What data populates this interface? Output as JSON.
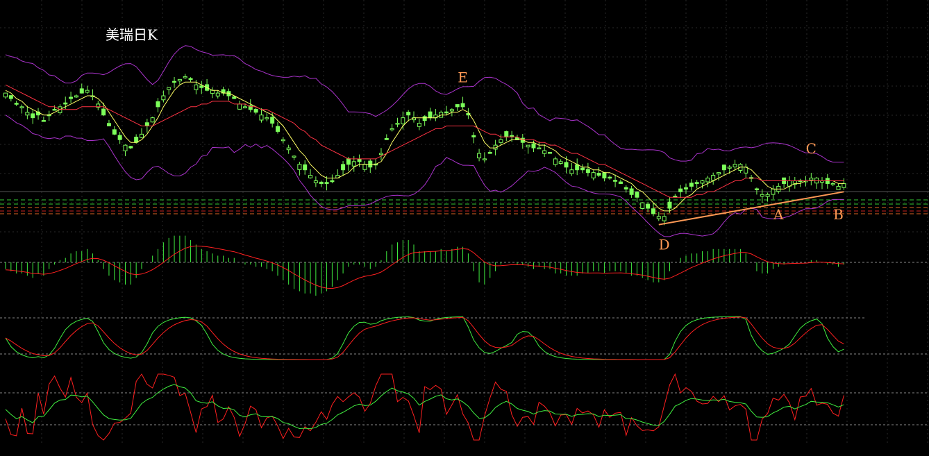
{
  "title": "美瑞日K",
  "colors": {
    "background": "#000000",
    "candle": "#7CFF5A",
    "ma_short": "#ffff66",
    "ma_long": "#ff3344",
    "bollinger": "#aa33cc",
    "annotation": "#ff9955",
    "macd_bar": "#40ee40",
    "macd_signal": "#ff2020",
    "kdj_fast": "#40ee40",
    "kdj_slow": "#ff2020",
    "ref_green": "#33cc33",
    "ref_orange": "#dd6622",
    "ref_red": "#cc2222"
  },
  "annotations": [
    {
      "label": "E",
      "i": 84
    },
    {
      "label": "D",
      "i": 121
    },
    {
      "label": "A",
      "i": 142
    },
    {
      "label": "C",
      "i": 148
    },
    {
      "label": "B",
      "i": 153
    }
  ],
  "trendline": {
    "from": 120,
    "to": 154
  },
  "chart_data": {
    "type": "candlestick",
    "closes": [
      112,
      110,
      108,
      107,
      105,
      103,
      104,
      102,
      104,
      106,
      107,
      108,
      110,
      111,
      112,
      113,
      111,
      108,
      104,
      100,
      97,
      95,
      93,
      92,
      94,
      97,
      100,
      103,
      107,
      111,
      114,
      116,
      117,
      118,
      117,
      115,
      114,
      113,
      113,
      112,
      112,
      111,
      110,
      108,
      107,
      106,
      105,
      104,
      103,
      101,
      98,
      95,
      92,
      89,
      86,
      84,
      82,
      80,
      79,
      79,
      80,
      82,
      84,
      86,
      87,
      87,
      86,
      85,
      86,
      90,
      95,
      99,
      101,
      103,
      104,
      103,
      101,
      102,
      103,
      104,
      105,
      105,
      106,
      107,
      107,
      104,
      96,
      90,
      88,
      90,
      93,
      95,
      96,
      96,
      95,
      94,
      93,
      92,
      92,
      91,
      90,
      88,
      87,
      85,
      84,
      84,
      84,
      83,
      83,
      82,
      81,
      81,
      80,
      79,
      77,
      75,
      74,
      72,
      70,
      68,
      67,
      67,
      70,
      74,
      76,
      77,
      78,
      79,
      80,
      81,
      82,
      83,
      84,
      85,
      86,
      86,
      85,
      81,
      77,
      75,
      75,
      77,
      78,
      79,
      80,
      80,
      80,
      80,
      81,
      81,
      80,
      79,
      79,
      78,
      79
    ],
    "ma_short": [
      113,
      112,
      110,
      109,
      107,
      106,
      105,
      104,
      104,
      105,
      106,
      107,
      108,
      109,
      110,
      111,
      111,
      110,
      108,
      105,
      102,
      99,
      96,
      94,
      94,
      95,
      97,
      100,
      103,
      107,
      110,
      113,
      115,
      116,
      116,
      116,
      115,
      114,
      113,
      113,
      112,
      112,
      111,
      110,
      109,
      108,
      107,
      106,
      105,
      104,
      102,
      100,
      97,
      94,
      91,
      89,
      86,
      84,
      82,
      81,
      81,
      81,
      82,
      83,
      85,
      86,
      86,
      86,
      86,
      87,
      90,
      94,
      97,
      100,
      102,
      103,
      103,
      103,
      103,
      103,
      104,
      104,
      105,
      105,
      106,
      105,
      102,
      98,
      94,
      92,
      92,
      93,
      94,
      95,
      95,
      95,
      94,
      94,
      93,
      93,
      92,
      91,
      89,
      88,
      87,
      86,
      85,
      85,
      84,
      84,
      83,
      83,
      82,
      81,
      80,
      79,
      77,
      76,
      74,
      72,
      70,
      69,
      69,
      70,
      72,
      74,
      75,
      77,
      78,
      79,
      80,
      81,
      82,
      83,
      84,
      85,
      85,
      84,
      82,
      80,
      78,
      77,
      77,
      77,
      78,
      79,
      79,
      80,
      80,
      80,
      80,
      80,
      80,
      79,
      79
    ],
    "ma_long": [
      115,
      114,
      113,
      112,
      111,
      110,
      109,
      108,
      107,
      107,
      106,
      106,
      106,
      106,
      107,
      107,
      107,
      107,
      107,
      106,
      105,
      104,
      103,
      102,
      101,
      100,
      100,
      100,
      101,
      102,
      103,
      104,
      105,
      106,
      107,
      107,
      108,
      108,
      109,
      109,
      109,
      109,
      108,
      108,
      108,
      107,
      107,
      106,
      106,
      105,
      104,
      103,
      102,
      101,
      99,
      98,
      96,
      95,
      93,
      92,
      91,
      90,
      89,
      88,
      88,
      88,
      88,
      88,
      88,
      89,
      90,
      91,
      92,
      93,
      94,
      95,
      96,
      97,
      98,
      99,
      99,
      100,
      100,
      100,
      100,
      100,
      100,
      99,
      98,
      97,
      97,
      96,
      96,
      96,
      96,
      95,
      95,
      95,
      94,
      94,
      93,
      93,
      92,
      91,
      90,
      90,
      89,
      88,
      87,
      86,
      86,
      85,
      84,
      83,
      82,
      81,
      80,
      79,
      78,
      77,
      76,
      75,
      74,
      74,
      74,
      74,
      74,
      75,
      75,
      76,
      76,
      77,
      78,
      79,
      80,
      80,
      81,
      81,
      81,
      80,
      80,
      80,
      80,
      80,
      80,
      80,
      80,
      80,
      80,
      80,
      80,
      80,
      80,
      80,
      80
    ]
  }
}
